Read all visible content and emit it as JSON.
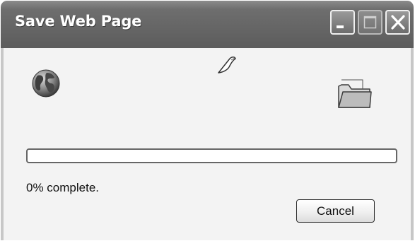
{
  "window": {
    "title": "Save Web Page",
    "controls": {
      "minimize": "minimize-icon",
      "maximize": "maximize-icon",
      "close": "close-icon"
    }
  },
  "animation": {
    "source_icon": "globe-icon",
    "moving_icon": "page-icon",
    "target_icon": "folder-icon"
  },
  "progress": {
    "percent": 0,
    "status_text": "0% complete."
  },
  "buttons": {
    "cancel_label": "Cancel"
  }
}
